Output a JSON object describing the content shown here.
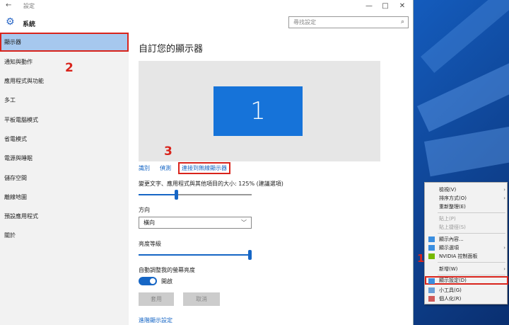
{
  "window": {
    "back_glyph": "←",
    "title": "設定",
    "minimize": "—",
    "maximize": "□",
    "close": "✕"
  },
  "header": {
    "app_title": "系統",
    "search_placeholder": "尋找設定",
    "search_icon": "⌕"
  },
  "sidebar": {
    "items": [
      {
        "label": "顯示器"
      },
      {
        "label": "通知與動作"
      },
      {
        "label": "應用程式與功能"
      },
      {
        "label": "多工"
      },
      {
        "label": "平板電腦模式"
      },
      {
        "label": "省電模式"
      },
      {
        "label": "電源與睡眠"
      },
      {
        "label": "儲存空間"
      },
      {
        "label": "離線地圖"
      },
      {
        "label": "預設應用程式"
      },
      {
        "label": "關於"
      }
    ]
  },
  "annotations": {
    "one": "1",
    "two": "2",
    "three": "3"
  },
  "main": {
    "heading": "自訂您的顯示器",
    "monitor_number": "1",
    "link_identify": "識別",
    "link_detect": "偵測",
    "link_wireless": "連接到無線顯示器",
    "scale_label": "變更文字、應用程式與其他項目的大小: 125% (建議選項)",
    "scale_value": 0.33,
    "orientation_label": "方向",
    "orientation_value": "橫向",
    "brightness_label": "亮度等級",
    "brightness_value": 1.0,
    "auto_brightness_label": "自動調整我的螢幕亮度",
    "toggle_state": "開啟",
    "apply_button": "套用",
    "cancel_button": "取消",
    "advanced_link": "進階顯示設定"
  },
  "context_menu": {
    "items": [
      {
        "label": "檢視(V)",
        "submenu": true
      },
      {
        "label": "排序方式(O)",
        "submenu": true
      },
      {
        "label": "重新整理(E)"
      },
      {
        "label": "貼上(P)",
        "disabled": true
      },
      {
        "label": "貼上捷徑(S)",
        "disabled": true
      },
      {
        "label": "顯示內容..."
      },
      {
        "label": "顯示選項",
        "submenu": true
      },
      {
        "label": "NVIDIA 控制面板"
      },
      {
        "label": "新增(W)",
        "submenu": true
      },
      {
        "label": "顯示設定(D)"
      },
      {
        "label": "小工具(G)"
      },
      {
        "label": "個人化(R)"
      }
    ],
    "submenu_arrow": "›"
  },
  "colors": {
    "accent": "#1666c5",
    "annotation": "#d9241c",
    "selected_nav": "#a6c8ee"
  }
}
